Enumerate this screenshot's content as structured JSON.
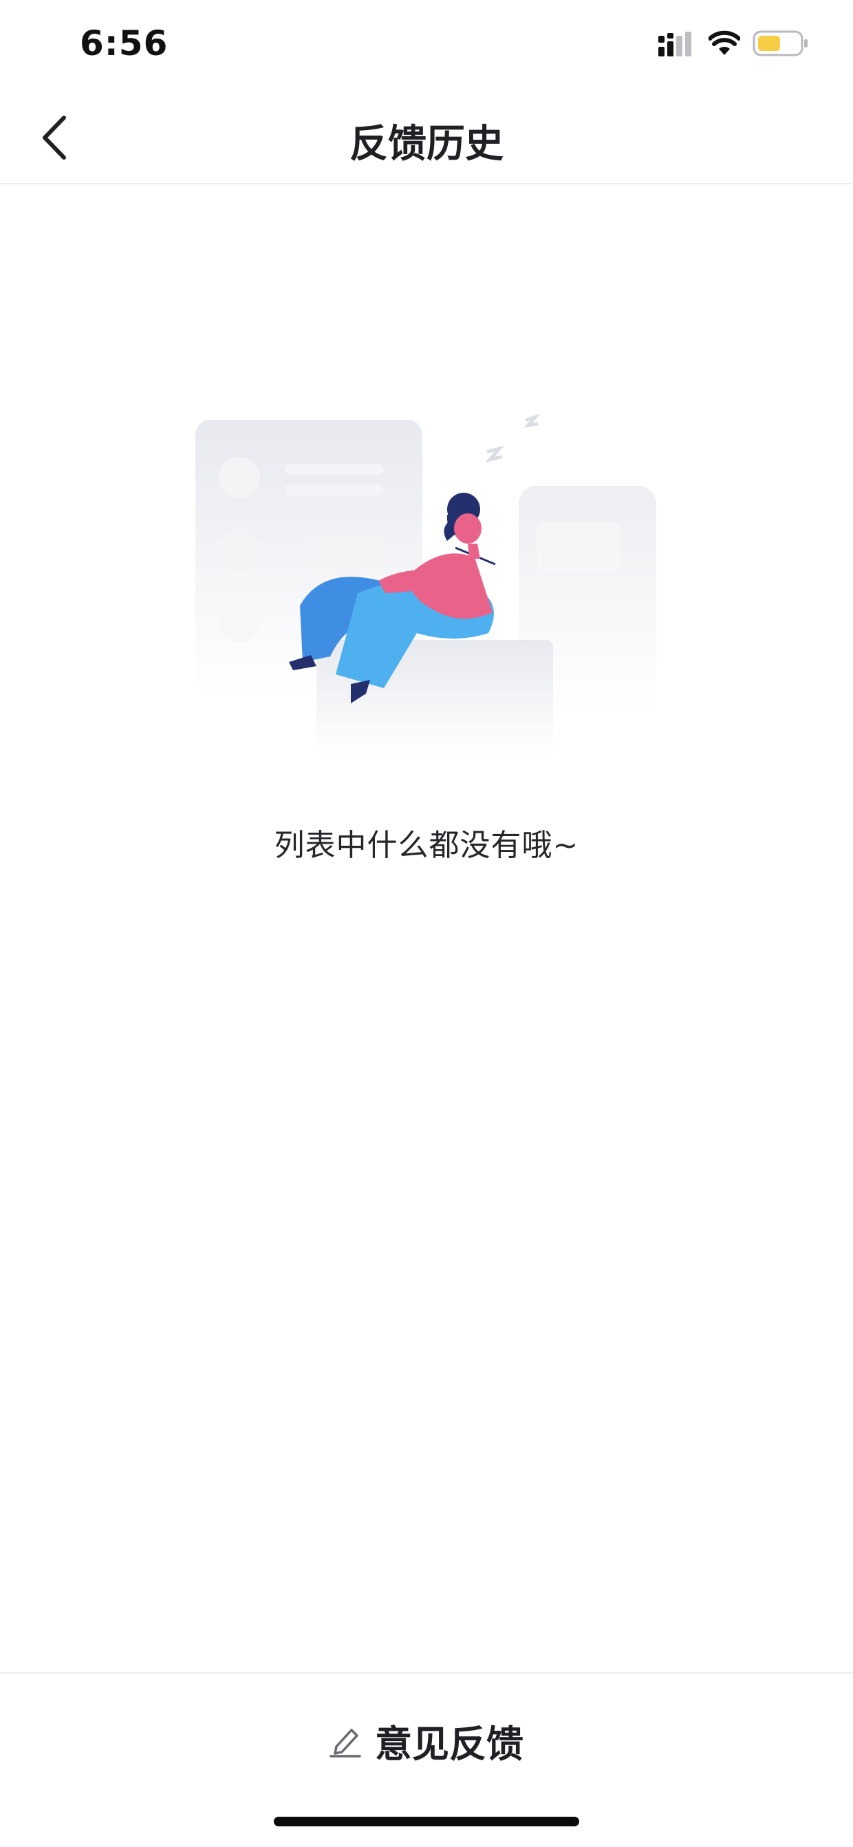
{
  "status_bar": {
    "time": "6:56",
    "battery_color": "#f7cd46"
  },
  "nav": {
    "title": "反馈历史",
    "back_icon": "chevron-left-icon"
  },
  "empty_state": {
    "message": "列表中什么都没有哦~",
    "illustration": "person-relaxing-on-blocks"
  },
  "bottom_bar": {
    "feedback_label": "意见反馈",
    "feedback_icon": "pencil-edit-icon"
  },
  "colors": {
    "text_primary": "#1f1f24",
    "divider": "#efeff2",
    "illustration_pink": "#e8628a",
    "illustration_blue": "#4fb0f0",
    "illustration_navy": "#24306e"
  }
}
